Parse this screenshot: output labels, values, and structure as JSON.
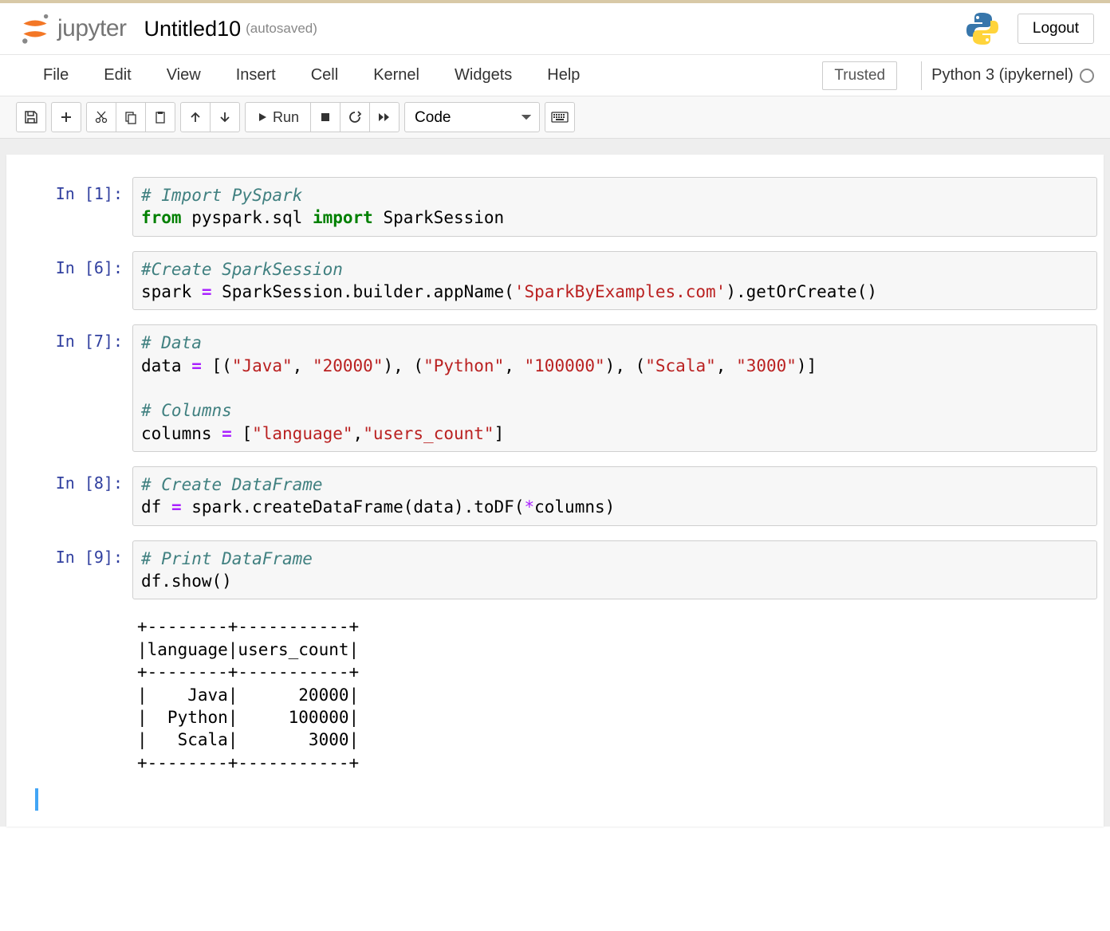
{
  "header": {
    "logo_text": "jupyter",
    "notebook_title": "Untitled10",
    "autosave_label": "(autosaved)",
    "logout_label": "Logout"
  },
  "menubar": {
    "items": [
      "File",
      "Edit",
      "View",
      "Insert",
      "Cell",
      "Kernel",
      "Widgets",
      "Help"
    ],
    "trusted_label": "Trusted",
    "kernel_name": "Python 3 (ipykernel)"
  },
  "toolbar": {
    "run_label": "Run",
    "celltype_value": "Code"
  },
  "cells": [
    {
      "prompt": "In [1]:",
      "code_tokens": [
        {
          "t": "# Import PySpark",
          "c": "comment"
        },
        {
          "t": "\n"
        },
        {
          "t": "from",
          "c": "keyword"
        },
        {
          "t": " pyspark.sql "
        },
        {
          "t": "import",
          "c": "keyword"
        },
        {
          "t": " SparkSession"
        }
      ]
    },
    {
      "prompt": "In [6]:",
      "code_tokens": [
        {
          "t": "#Create SparkSession",
          "c": "comment"
        },
        {
          "t": "\n"
        },
        {
          "t": "spark "
        },
        {
          "t": "=",
          "c": "op"
        },
        {
          "t": " SparkSession.builder.appName("
        },
        {
          "t": "'SparkByExamples.com'",
          "c": "string"
        },
        {
          "t": ").getOrCreate()"
        }
      ]
    },
    {
      "prompt": "In [7]:",
      "code_tokens": [
        {
          "t": "# Data",
          "c": "comment"
        },
        {
          "t": "\n"
        },
        {
          "t": "data "
        },
        {
          "t": "=",
          "c": "op"
        },
        {
          "t": " [("
        },
        {
          "t": "\"Java\"",
          "c": "string"
        },
        {
          "t": ", "
        },
        {
          "t": "\"20000\"",
          "c": "string"
        },
        {
          "t": "), ("
        },
        {
          "t": "\"Python\"",
          "c": "string"
        },
        {
          "t": ", "
        },
        {
          "t": "\"100000\"",
          "c": "string"
        },
        {
          "t": "), ("
        },
        {
          "t": "\"Scala\"",
          "c": "string"
        },
        {
          "t": ", "
        },
        {
          "t": "\"3000\"",
          "c": "string"
        },
        {
          "t": ")]"
        },
        {
          "t": "\n\n"
        },
        {
          "t": "# Columns",
          "c": "comment"
        },
        {
          "t": "\n"
        },
        {
          "t": "columns "
        },
        {
          "t": "=",
          "c": "op"
        },
        {
          "t": " ["
        },
        {
          "t": "\"language\"",
          "c": "string"
        },
        {
          "t": ","
        },
        {
          "t": "\"users_count\"",
          "c": "string"
        },
        {
          "t": "]"
        }
      ]
    },
    {
      "prompt": "In [8]:",
      "code_tokens": [
        {
          "t": "# Create DataFrame",
          "c": "comment"
        },
        {
          "t": "\n"
        },
        {
          "t": "df "
        },
        {
          "t": "=",
          "c": "op"
        },
        {
          "t": " spark.createDataFrame(data).toDF("
        },
        {
          "t": "*",
          "c": "star"
        },
        {
          "t": "columns)"
        }
      ]
    },
    {
      "prompt": "In [9]:",
      "code_tokens": [
        {
          "t": "# Print DataFrame",
          "c": "comment"
        },
        {
          "t": "\n"
        },
        {
          "t": "df.show()"
        }
      ],
      "output": "+--------+-----------+\n|language|users_count|\n+--------+-----------+\n|    Java|      20000|\n|  Python|     100000|\n|   Scala|       3000|\n+--------+-----------+"
    }
  ]
}
